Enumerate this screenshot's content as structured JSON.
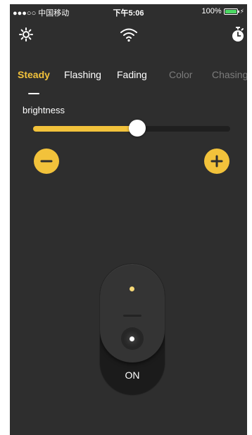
{
  "status_bar": {
    "carrier": "●●●○○ 中国移动",
    "time": "下午5:06",
    "battery_text": "100%",
    "battery_level": 1.0
  },
  "topbar": {
    "left_icon": "settings-sun-icon",
    "center_icon": "wifi-icon",
    "right_icon": "timer-icon"
  },
  "tabs": [
    {
      "label": "Steady",
      "state": "active"
    },
    {
      "label": "Flashing",
      "state": "normal"
    },
    {
      "label": "Fading",
      "state": "normal"
    },
    {
      "label": "Color",
      "state": "disabled"
    },
    {
      "label": "Chasing",
      "state": "disabled"
    }
  ],
  "brightness": {
    "label": "brightness",
    "value": 0.53
  },
  "switch": {
    "label": "ON"
  },
  "colors": {
    "accent": "#f2c23b",
    "background": "#2e2e2e",
    "disabled_tab": "#7c7c7c"
  }
}
